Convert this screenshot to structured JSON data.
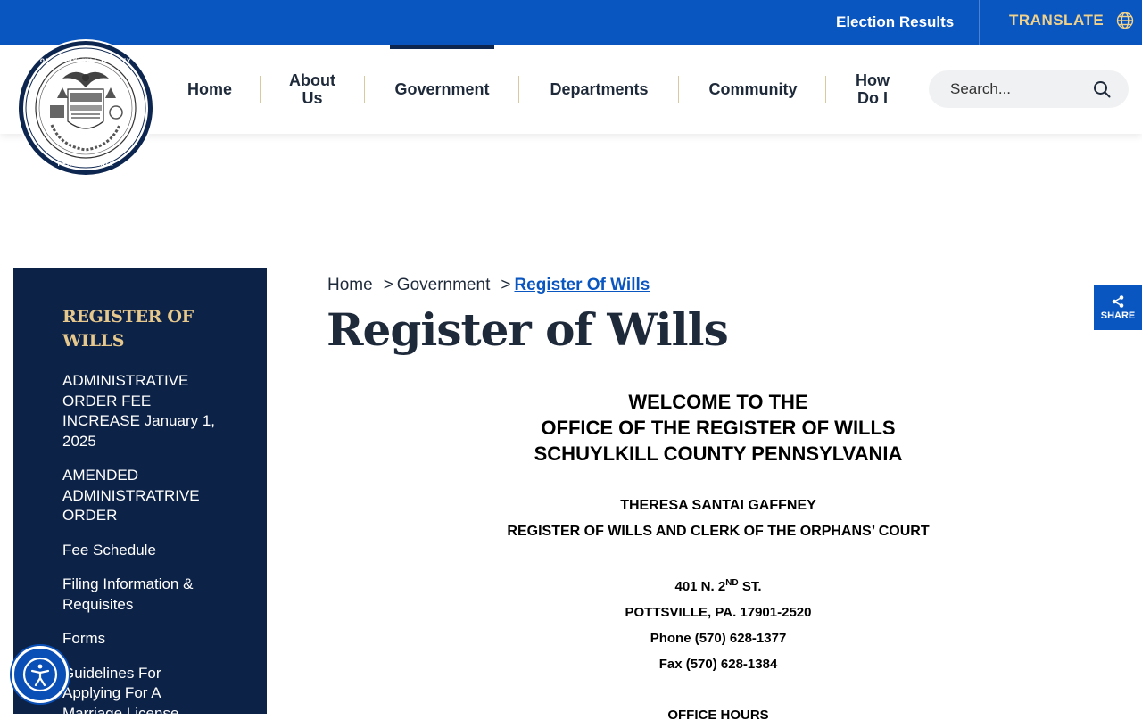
{
  "topbar": {
    "election_results": "Election Results",
    "translate": "TRANSLATE"
  },
  "header": {
    "seal_text_top": "SEAL OF SCHUYLKILL COUNTY 1811",
    "seal_text_bottom": "PENNSYLVANIA",
    "nav": [
      {
        "label": "Home"
      },
      {
        "label": "About Us"
      },
      {
        "label": "Government",
        "active": true
      },
      {
        "label": "Departments"
      },
      {
        "label": "Community"
      },
      {
        "label": "How Do I"
      }
    ],
    "search_placeholder": "Search..."
  },
  "sidebar": {
    "title": "REGISTER OF WILLS",
    "items": [
      "ADMINISTRATIVE ORDER FEE INCREASE January 1, 2025",
      "AMENDED ADMINISTRATRIVE ORDER",
      "Fee Schedule",
      "Filing Information & Requisites",
      "Forms",
      "Guidelines For Applying For A Marriage License"
    ]
  },
  "share": {
    "label": "SHARE"
  },
  "breadcrumb": {
    "home": "Home",
    "separator": ">",
    "government": "Government",
    "current": "Register Of Wills"
  },
  "page": {
    "title": "Register of Wills",
    "welcome_1": "WELCOME TO THE",
    "welcome_2": "OFFICE OF THE REGISTER OF WILLS",
    "welcome_3": "SCHUYLKILL COUNTY PENNSYLVANIA",
    "official_name": "THERESA SANTAI GAFFNEY",
    "official_title": "REGISTER OF WILLS AND CLERK OF THE ORPHANS’ COURT",
    "address_prefix": "401 N. 2",
    "address_sup": "ND",
    "address_suffix": " ST.",
    "city": "POTTSVILLE, PA. 17901-2520",
    "phone": "Phone (570) 628-1377",
    "fax": "Fax (570) 628-1384",
    "office_hours": "OFFICE HOURS"
  },
  "colors": {
    "topbar_blue": "#0a56c0",
    "sidebar_navy": "#0d2247",
    "gold": "#e6c88c",
    "link_blue": "#0a56c0"
  },
  "icons": [
    "globe-icon",
    "search-icon",
    "share-icon",
    "accessibility-icon",
    "county-seal"
  ]
}
